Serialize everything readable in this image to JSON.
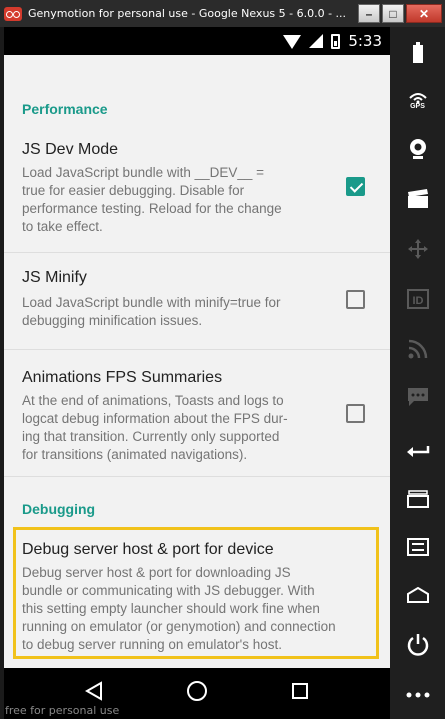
{
  "window": {
    "title": "Genymotion for personal use - Google Nexus 5 - 6.0.0 - ...",
    "minimize": "–",
    "maximize": "□",
    "close": "✕"
  },
  "statusbar": {
    "time": "5:33"
  },
  "sections": {
    "performance": "Performance",
    "debugging": "Debugging"
  },
  "prefs": [
    {
      "title": "JS Dev Mode",
      "summary": [
        "Load JavaScript bundle with __DEV__ =",
        "true for easier debugging.  Disable for",
        "performance testing. Reload for the change",
        "to take effect."
      ],
      "checked": true
    },
    {
      "title": "JS Minify",
      "summary": [
        "Load JavaScript bundle with minify=true for",
        "debugging minification issues."
      ],
      "checked": false
    },
    {
      "title": "Animations FPS Summaries",
      "summary": [
        "At the end of animations, Toasts and logs to",
        "logcat debug information about the FPS dur-",
        "ing that transition. Currently only supported",
        "for transitions (animated navigations)."
      ],
      "checked": false
    },
    {
      "title": "Debug server host & port for device",
      "summary": [
        "Debug server host & port for downloading JS",
        "bundle or communicating with JS debugger. With",
        "this setting empty launcher should work fine when",
        "running on emulator (or genymotion) and connection",
        "to debug server running on emulator's host."
      ]
    }
  ],
  "watermark": "free for personal use",
  "sidebar": {
    "gps_label": "GPS"
  },
  "colors": {
    "accent": "#1a9a8a",
    "highlight": "#f1c21b"
  }
}
